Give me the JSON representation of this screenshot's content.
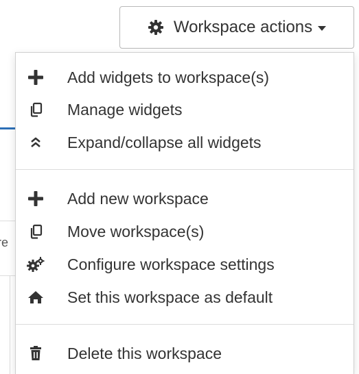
{
  "background": {
    "fragment_text": "re"
  },
  "header": {
    "workspace_actions_label": "Workspace actions"
  },
  "menu": {
    "groups": [
      {
        "items": [
          {
            "label": "Add widgets to workspace(s)",
            "icon": "plus-icon"
          },
          {
            "label": "Manage widgets",
            "icon": "copy-icon"
          },
          {
            "label": "Expand/collapse all widgets",
            "icon": "double-chevron-up-icon"
          }
        ]
      },
      {
        "items": [
          {
            "label": "Add new workspace",
            "icon": "plus-icon"
          },
          {
            "label": "Move workspace(s)",
            "icon": "copy-icon"
          },
          {
            "label": "Configure workspace settings",
            "icon": "cogs-icon"
          },
          {
            "label": "Set this workspace as default",
            "icon": "home-icon"
          }
        ]
      },
      {
        "items": [
          {
            "label": "Delete this workspace",
            "icon": "trash-icon"
          }
        ]
      }
    ]
  },
  "colors": {
    "text": "#333333",
    "border": "#b8b8b8",
    "divider": "#dcdcdc",
    "accent": "#2c6fb7"
  }
}
